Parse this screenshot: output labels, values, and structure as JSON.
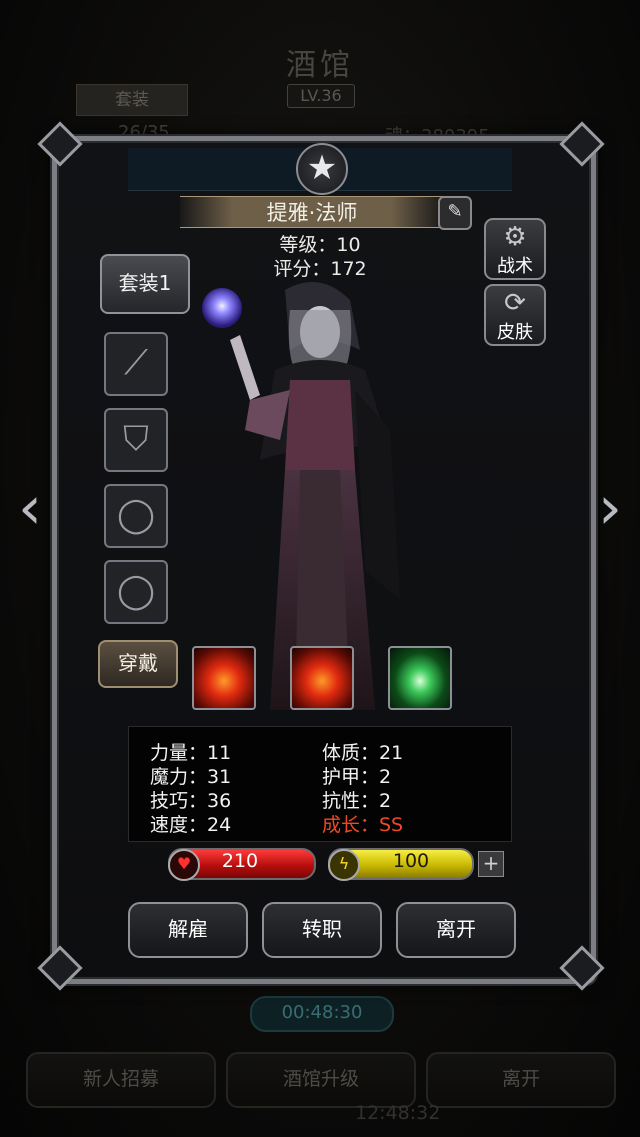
{
  "background": {
    "title": "酒馆",
    "tab_label": "套装",
    "level": "LV.36",
    "stat_left": "26/35",
    "stat_right": "魂：380395",
    "timer": "00:48:30",
    "buttons": [
      "新人招募",
      "酒馆升级",
      "离开"
    ],
    "bottom_time": "12:48:32"
  },
  "hero": {
    "name": "提雅·法师",
    "level_text": "等级：10",
    "score_text": "评分：172"
  },
  "side_buttons": [
    {
      "label": "战术",
      "icon": "gear-icon"
    },
    {
      "label": "皮肤",
      "icon": "armor-refresh-icon"
    }
  ],
  "outfit_button": "套装1",
  "equip_button": "穿戴",
  "equipment_slots": [
    {
      "name": "weapon-slot",
      "icon": "staff-icon"
    },
    {
      "name": "armor-slot",
      "icon": "armor-icon"
    },
    {
      "name": "ring-slot-1",
      "icon": "ring-icon"
    },
    {
      "name": "ring-slot-2",
      "icon": "ring-icon"
    }
  ],
  "skills": [
    {
      "name": "fire-skill-1",
      "icon": "fire-skill-icon"
    },
    {
      "name": "fire-skill-2",
      "icon": "fire-skill-icon"
    },
    {
      "name": "green-crystal-skill",
      "icon": "green-crystal-icon"
    }
  ],
  "stats": {
    "strength": "力量：11",
    "constitution": "体质：21",
    "magic": "魔力：31",
    "armor": "护甲：2",
    "skill": "技巧：36",
    "resistance": "抗性：2",
    "speed": "速度：24",
    "growth": "成长：SS"
  },
  "bars": {
    "hp": "210",
    "energy": "100"
  },
  "actions": {
    "dismiss": "解雇",
    "transfer": "转职",
    "leave": "离开"
  },
  "colors": {
    "growth": "#f04a22",
    "hp": "#d21a1a",
    "energy": "#e0d21a"
  }
}
